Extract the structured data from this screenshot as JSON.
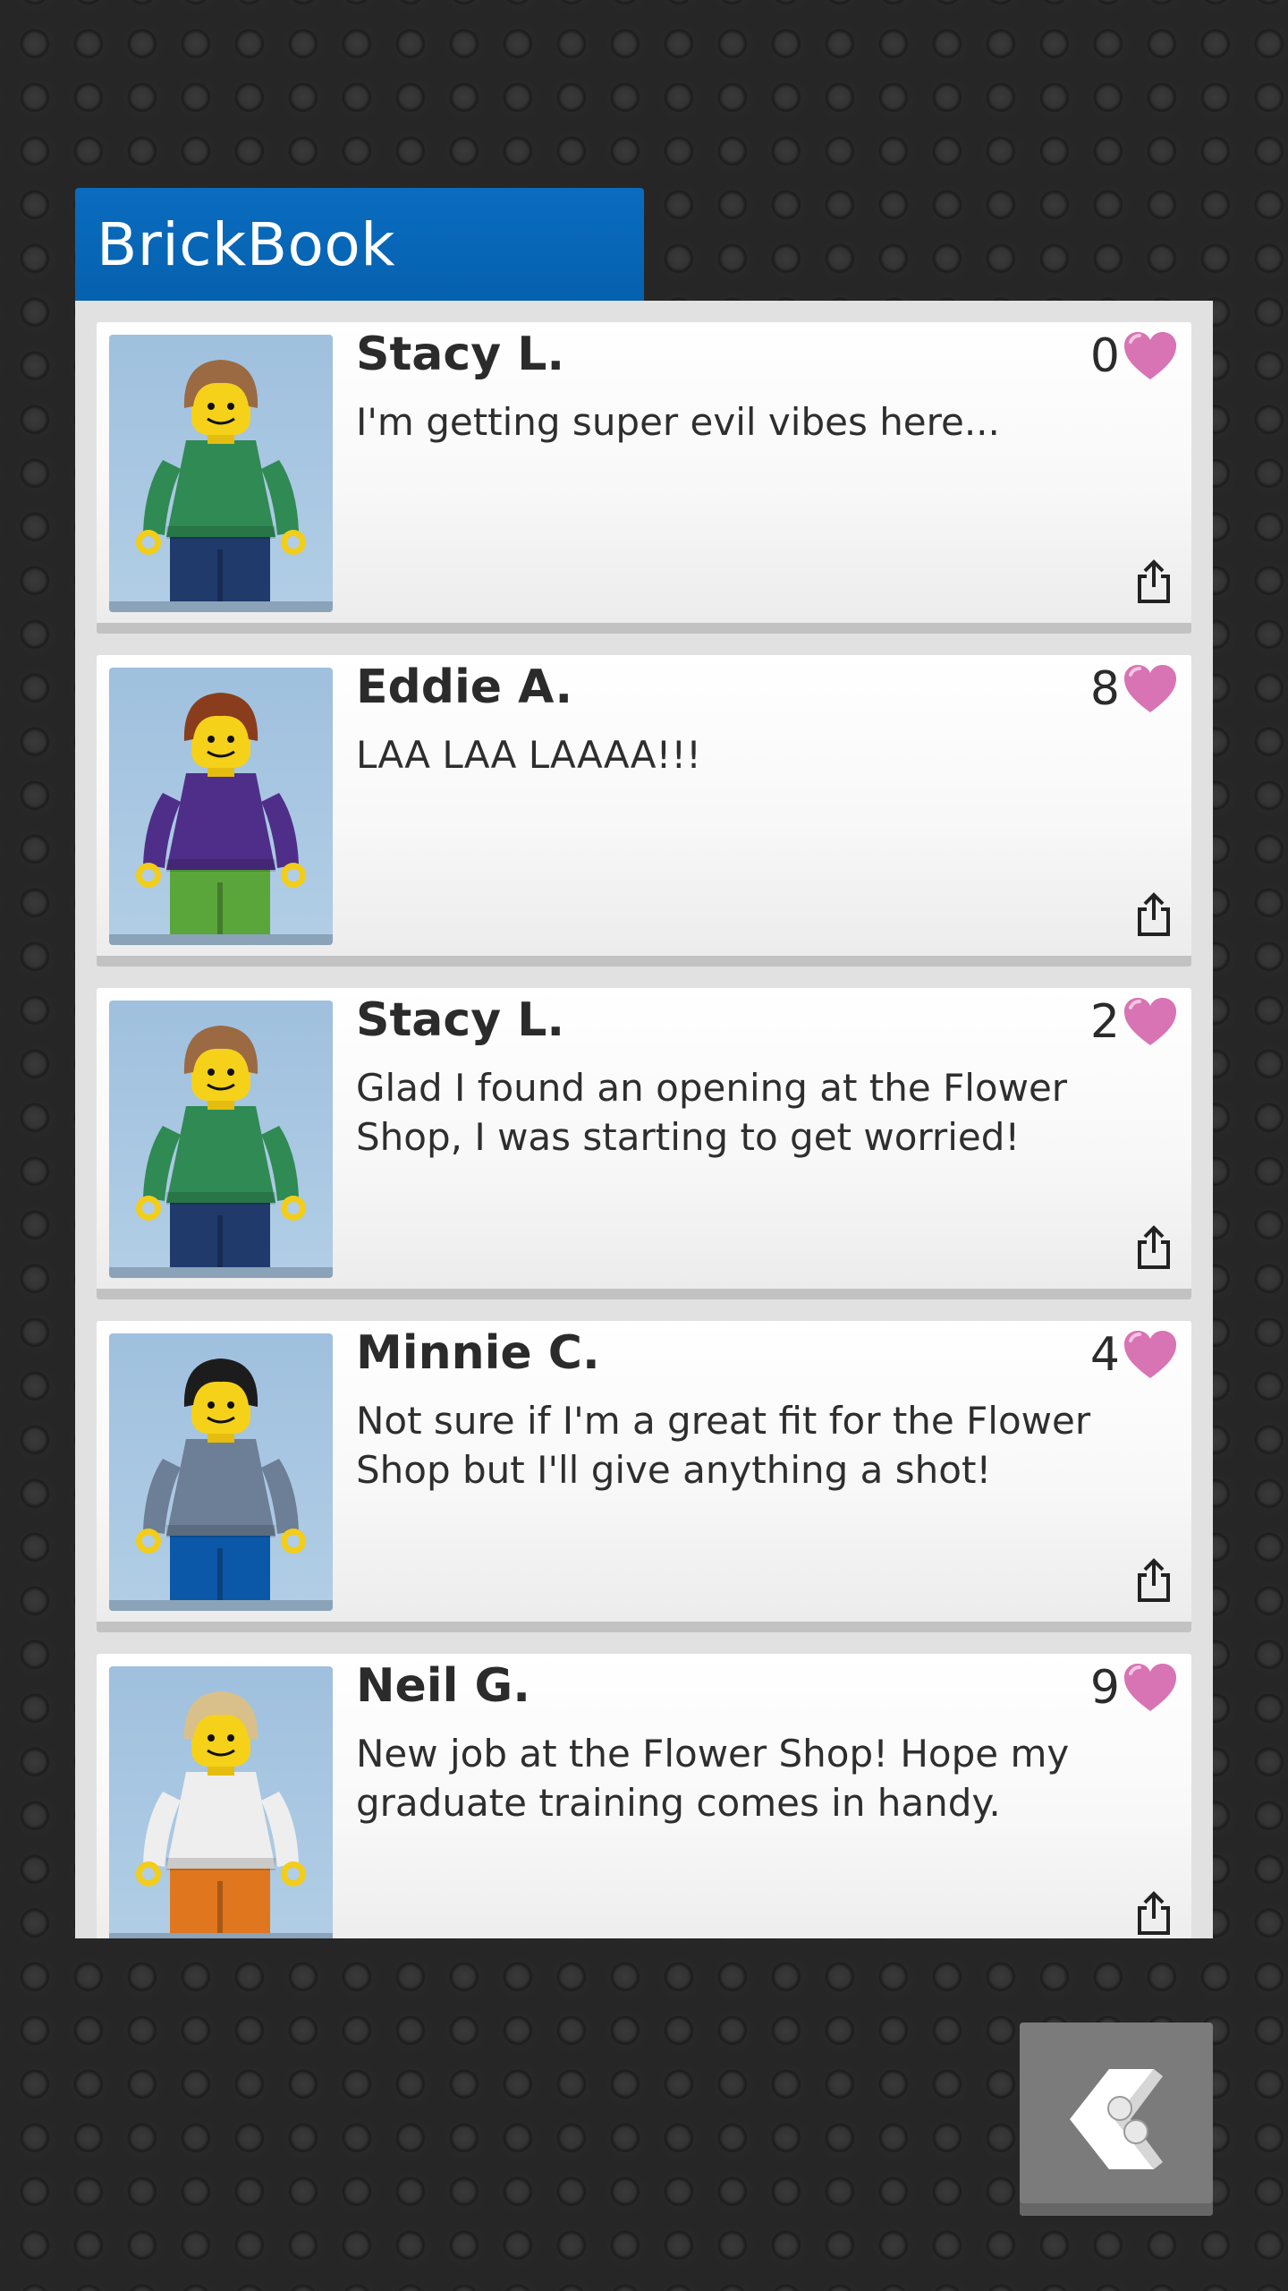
{
  "app": {
    "title": "BrickBook"
  },
  "posts": [
    {
      "author": "Stacy L.",
      "message": "I'm getting super evil vibes here...",
      "likes": "0",
      "avatar": {
        "hair": "#9b6a42",
        "torso": "#2f8a53",
        "legs": "#1f3a6b"
      }
    },
    {
      "author": "Eddie A.",
      "message": "LAA LAA LAAAA!!!",
      "likes": "8",
      "avatar": {
        "hair": "#8a3d1c",
        "torso": "#4f2e89",
        "legs": "#5aa63a"
      }
    },
    {
      "author": "Stacy L.",
      "message": "Glad I found an opening at the Flower Shop, I was starting to get worried!",
      "likes": "2",
      "avatar": {
        "hair": "#9b6a42",
        "torso": "#2f8a53",
        "legs": "#1f3a6b"
      }
    },
    {
      "author": "Minnie C.",
      "message": "Not sure if I'm a great fit for the Flower Shop but I'll give anything a shot!",
      "likes": "4",
      "avatar": {
        "hair": "#1c1c1c",
        "torso": "#6c7f96",
        "legs": "#0c58a8"
      }
    },
    {
      "author": "Neil G.",
      "message": "New job at the Flower Shop! Hope my graduate training comes in handy.",
      "likes": "9",
      "avatar": {
        "hair": "#d9c08a",
        "torso": "#eeeeee",
        "legs": "#e0761e"
      }
    }
  ],
  "colors": {
    "header": "#0a6cc0",
    "heart": "#d873b4"
  },
  "icons": {
    "like": "heart-icon",
    "share": "share-icon",
    "back": "brick-back-icon"
  }
}
